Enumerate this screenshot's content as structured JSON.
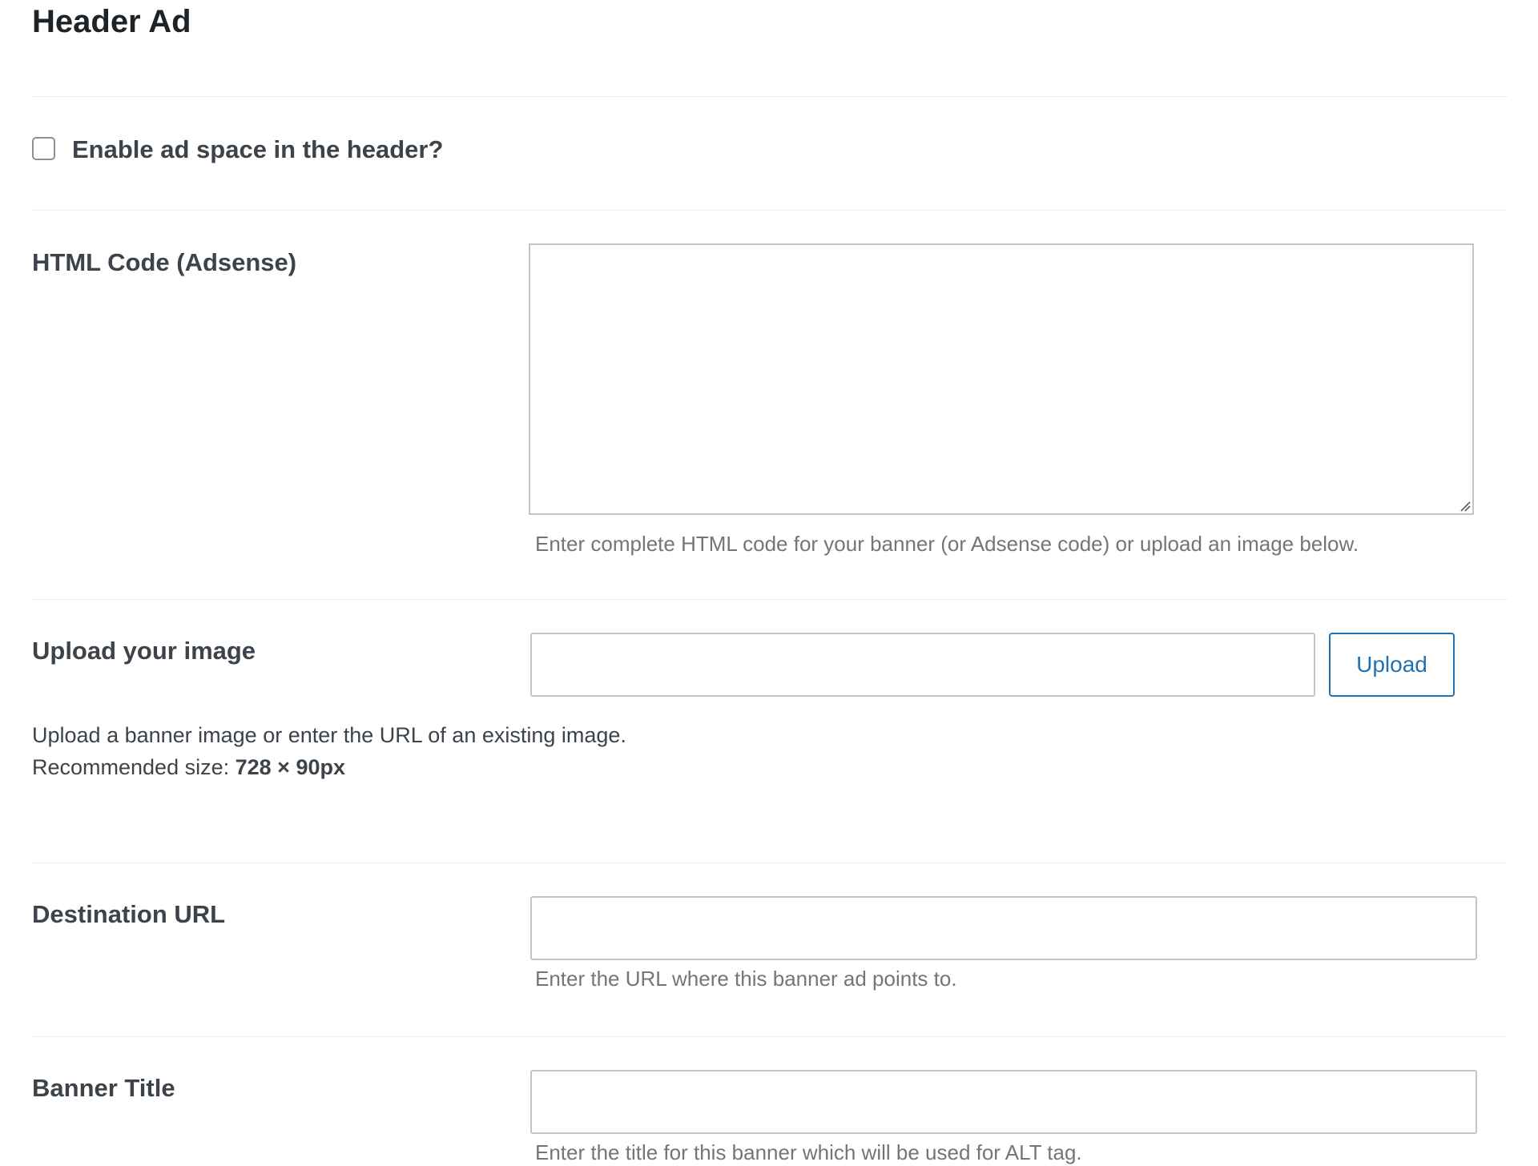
{
  "section": {
    "title": "Header Ad"
  },
  "enable": {
    "label": "Enable ad space in the header?",
    "checked": false
  },
  "html_code": {
    "label": "HTML Code (Adsense)",
    "value": "",
    "help": "Enter complete HTML code for your banner (or Adsense code) or upload an image below."
  },
  "upload": {
    "label": "Upload your image",
    "value": "",
    "button_label": "Upload",
    "description_line1": "Upload a banner image or enter the URL of an existing image.",
    "description_prefix": "Recommended size: ",
    "recommended_size": "728 × 90px"
  },
  "destination": {
    "label": "Destination URL",
    "value": "",
    "help": "Enter the URL where this banner ad points to."
  },
  "banner_title": {
    "label": "Banner Title",
    "value": "",
    "help": "Enter the title for this banner which will be used for ALT tag."
  },
  "colors": {
    "accent": "#2271b1",
    "label_text": "#3c434a",
    "help_text": "#757575",
    "border": "#c3c4c7",
    "divider": "#ececec"
  }
}
